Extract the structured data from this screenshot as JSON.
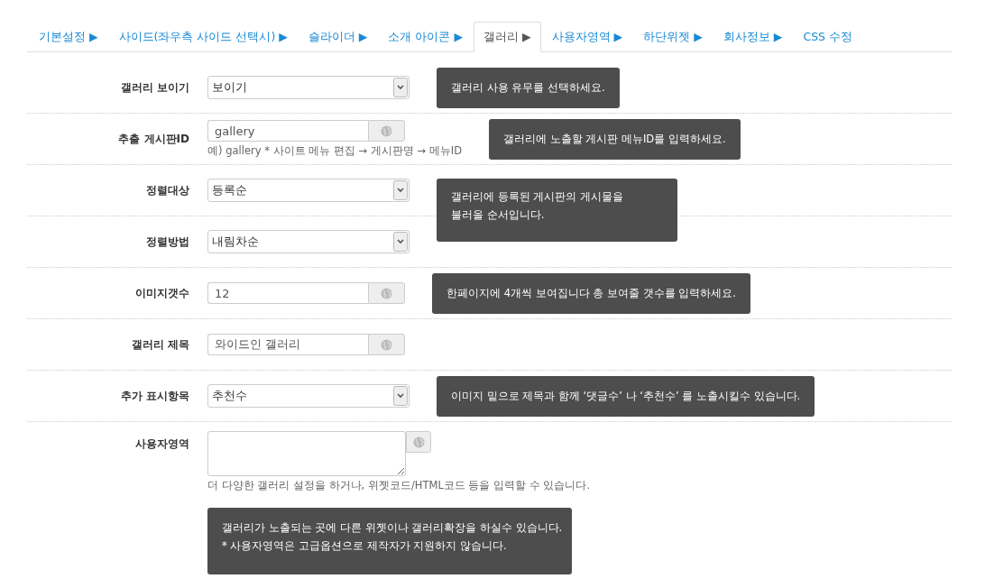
{
  "tabs": [
    {
      "label": "기본설정 ▶",
      "selected": false
    },
    {
      "label": "사이드(좌우측 사이드 선택시) ▶",
      "selected": false
    },
    {
      "label": "슬라이더 ▶",
      "selected": false
    },
    {
      "label": "소개 아이콘 ▶",
      "selected": false
    },
    {
      "label": "갤러리 ▶",
      "selected": true
    },
    {
      "label": "사용자영역 ▶",
      "selected": false
    },
    {
      "label": "하단위젯 ▶",
      "selected": false
    },
    {
      "label": "회사정보 ▶",
      "selected": false
    },
    {
      "label": "CSS 수정",
      "selected": false
    }
  ],
  "rows": [
    {
      "label": "갤러리 보이기",
      "kind": "select",
      "value": "보이기",
      "tooltip": [
        "갤러리 사용 유무를 선택하세요."
      ]
    },
    {
      "label": "추출 게시판ID",
      "kind": "input",
      "value": "gallery",
      "hint": "예) gallery * 사이트 메뉴 편집 → 게시판명 → 메뉴ID",
      "tooltip": [
        "갤러리에 노출할 게시판 메뉴ID를 입력하세요."
      ]
    },
    {
      "label": "정렬대상",
      "kind": "select",
      "value": "등록순",
      "tooltip": [
        "갤러리에 등록된 게시판의 게시물을",
        "불러올 순서입니다."
      ]
    },
    {
      "label": "정렬방법",
      "kind": "select",
      "value": "내림차순"
    },
    {
      "label": "이미지갯수",
      "kind": "input",
      "value": "12",
      "tooltip": [
        "한페이지에 4개씩 보여집니다 총 보여줄 갯수를 입력하세요."
      ]
    },
    {
      "label": "갤러리 제목",
      "kind": "input",
      "value": "와이드인 갤러리"
    },
    {
      "label": "추가 표시항목",
      "kind": "select",
      "value": "추천수",
      "tooltip": [
        "이미지 밑으로 제목과 함께 ‘댓글수’ 나 ‘추천수’ 를 노출시킬수 있습니다."
      ]
    },
    {
      "label": "사용자영역",
      "kind": "textarea",
      "hint": "더 다양한 갤러리 설정을 하거나, 위젯코드/HTML코드 등을 입력할 수 있습니다.",
      "tooltip": [
        "갤러리가 노출되는 곳에 다른 위젯이나 갤러리확장을 하실수 있습니다.",
        "* 사용자영역은 고급옵션으로 제작자가 지원하지 않습니다."
      ]
    }
  ]
}
